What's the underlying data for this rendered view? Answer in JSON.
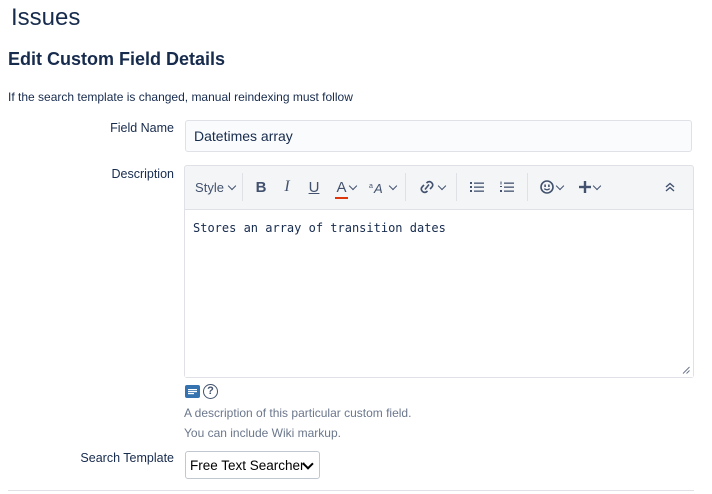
{
  "header": {
    "title": "Issues",
    "section_title": "Edit Custom Field Details",
    "notice": "If the search template is changed, manual reindexing must follow"
  },
  "form": {
    "field_name": {
      "label": "Field Name",
      "value": "Datetimes array"
    },
    "description": {
      "label": "Description",
      "value": "Stores an array of transition dates",
      "toolbar": {
        "style_label": "Style",
        "bold_label": "B",
        "italic_label": "I",
        "underline_label": "U",
        "text_color_label": "A",
        "icons": [
          "bold-icon",
          "italic-icon",
          "underline-icon",
          "text-color-icon",
          "text-size-icon",
          "link-icon",
          "bullet-list-icon",
          "numbered-list-icon",
          "emoji-icon",
          "insert-more-icon",
          "collapse-icon"
        ]
      },
      "help_line_1": "A description of this particular custom field.",
      "help_line_2": "You can include Wiki markup."
    },
    "search_template": {
      "label": "Search Template",
      "selected": "Free Text Searcher"
    }
  },
  "colors": {
    "text": "#172b4d",
    "muted": "#6b778c",
    "border": "#dfe1e6",
    "toolbar_bg": "#f4f5f7",
    "accent": "#3572b0",
    "color_underline": "#de350b"
  }
}
